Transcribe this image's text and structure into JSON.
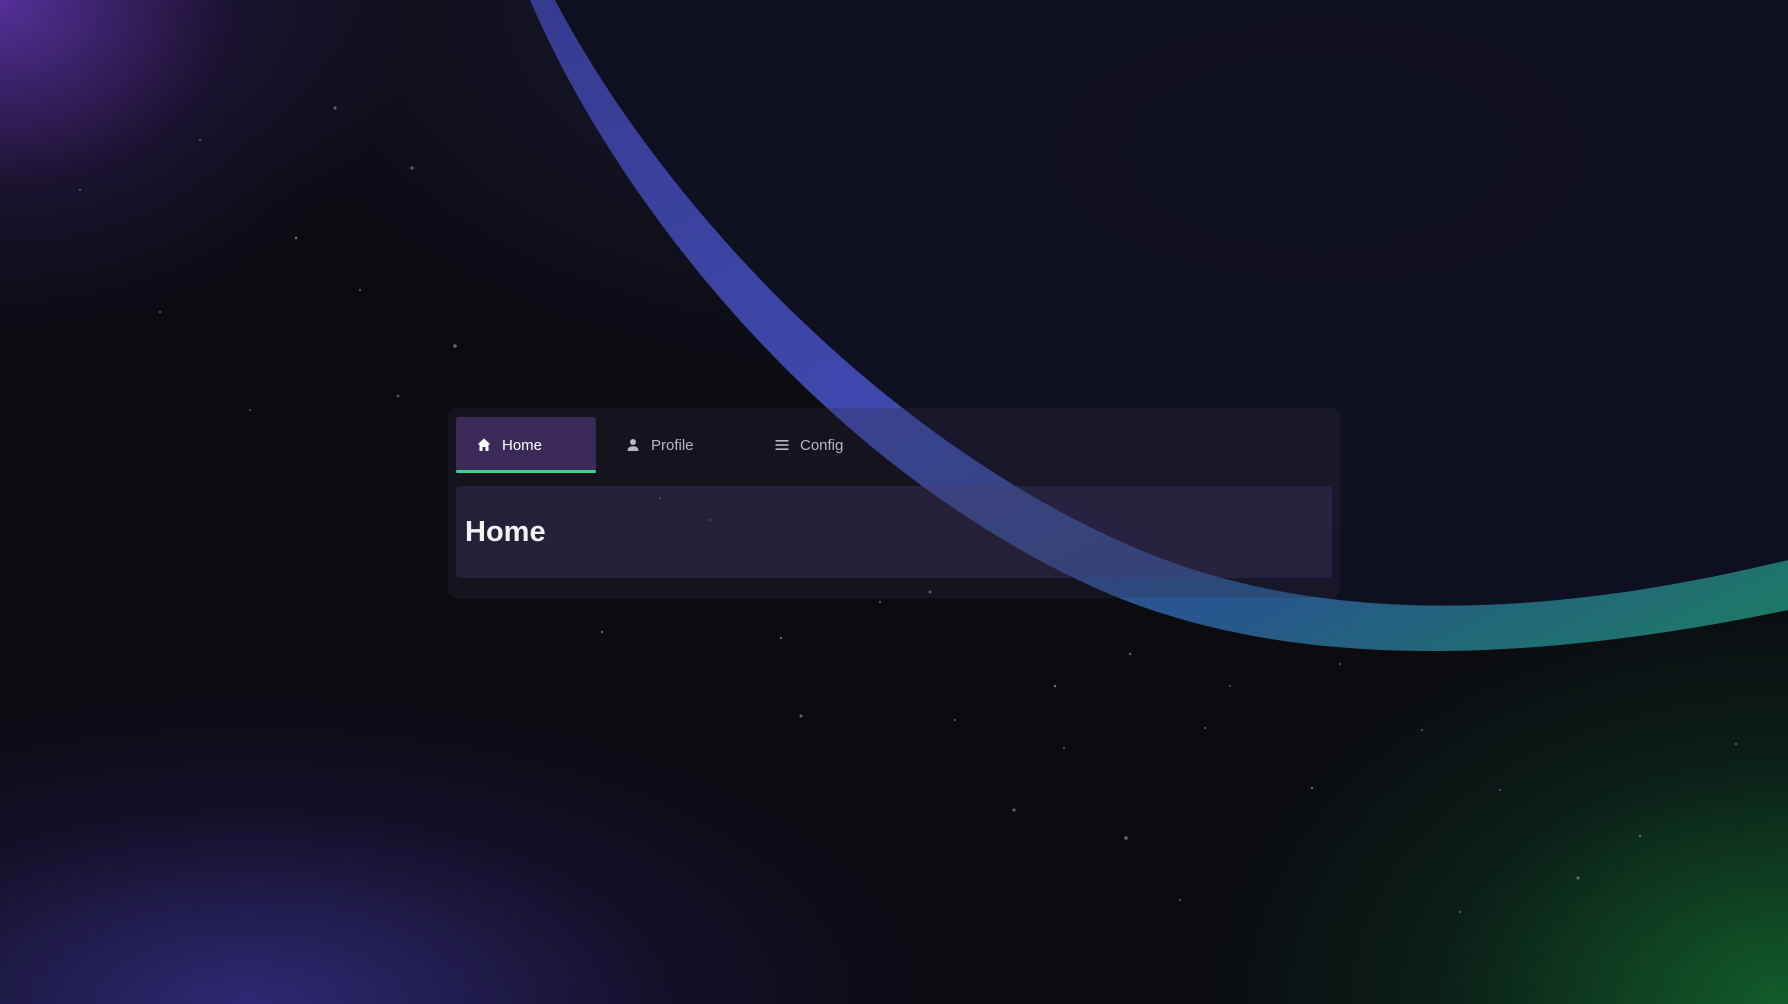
{
  "tabs": [
    {
      "label": "Home",
      "icon": "home-icon",
      "active": true
    },
    {
      "label": "Profile",
      "icon": "user-icon",
      "active": false
    },
    {
      "label": "Config",
      "icon": "menu-icon",
      "active": false
    }
  ],
  "content": {
    "heading": "Home"
  },
  "colors": {
    "accent": "#3fd08a",
    "active_tab_bg": "#46326e",
    "planet_edge": "#4a56c8"
  }
}
